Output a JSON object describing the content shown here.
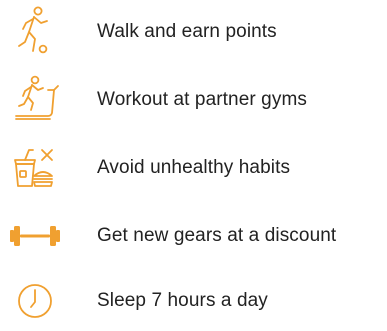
{
  "accent_color": "#f0a030",
  "features": [
    {
      "icon": "walking-person-icon",
      "label": "Walk and earn points"
    },
    {
      "icon": "treadmill-icon",
      "label": "Workout at partner gyms"
    },
    {
      "icon": "junk-food-crossed-icon",
      "label": "Avoid unhealthy habits"
    },
    {
      "icon": "dumbbell-icon",
      "label": "Get new gears at a discount"
    },
    {
      "icon": "clock-icon",
      "label": "Sleep 7 hours a day"
    }
  ]
}
